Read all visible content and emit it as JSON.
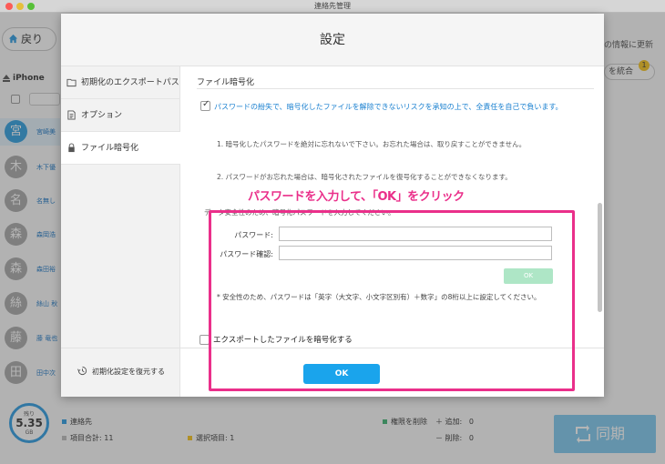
{
  "window": {
    "title": "連絡先管理"
  },
  "app": {
    "back_label": "戻り",
    "toolbar_right": "の情報に更新",
    "merge_label": "を統合",
    "merge_badge": "1",
    "device_name": "iPhone",
    "contacts": [
      {
        "initial": "宮",
        "name": "宮崎美"
      },
      {
        "initial": "木",
        "name": "木下優"
      },
      {
        "initial": "名",
        "name": "名無し"
      },
      {
        "initial": "森",
        "name": "森岡浩"
      },
      {
        "initial": "森",
        "name": "森田裕"
      },
      {
        "initial": "絲",
        "name": "絲山 秋"
      },
      {
        "initial": "藤",
        "name": "藤 竜也"
      },
      {
        "initial": "田",
        "name": "田中次"
      }
    ],
    "storage": {
      "label": "残り",
      "value": "5.35",
      "unit": "GB"
    },
    "legend": {
      "contacts": "連絡先",
      "total_items": "項目合計: 11",
      "selected_items": "選択項目: 1",
      "permission_delete": "権限を削除",
      "add": "追加:",
      "add_count": "0",
      "delete": "削除:",
      "delete_count": "0"
    },
    "sync_label": "同期",
    "colors": {
      "accent": "#2d9fe0",
      "legend_contacts": "#2a9be2",
      "legend_selected": "#f5c21b",
      "legend_delete": "#3cb371"
    }
  },
  "modal": {
    "title": "設定",
    "nav": [
      {
        "label": "初期化のエクスポートパス",
        "icon": "folder-icon"
      },
      {
        "label": "オプション",
        "icon": "document-icon"
      },
      {
        "label": "ファイル暗号化",
        "icon": "lock-icon"
      }
    ],
    "restore_label": "初期化設定を復元する",
    "section_title": "ファイル暗号化",
    "warning": "パスワードの紛失で、暗号化したファイルを解除できないリスクを承知の上で、全責任を自己で負います。",
    "note1": "1. 暗号化したパスワードを絶対に忘れないで下さい。お忘れた場合は、取り戻すことができません。",
    "note2": "2. パスワードがお忘れた場合は、暗号化されたファイルを復号化することができなくなります。",
    "note3": "データ安全性のため、暗号化パスワードを入力してください。",
    "password_label": "パスワード:",
    "password_value": "",
    "confirm_label": "パスワード確認:",
    "confirm_value": "",
    "inner_ok_label": "OK",
    "safe_note": "* 安全性のため、パスワードは「英字（大文字、小文字区別有）＋数字」の8桁以上に設定してください。",
    "encrypt_label": "エクスポートしたファイルを暗号化する",
    "ok_label": "OK"
  },
  "annotation": {
    "text": "パスワードを入力して、「OK」をクリック",
    "color": "#ea2f8a"
  }
}
